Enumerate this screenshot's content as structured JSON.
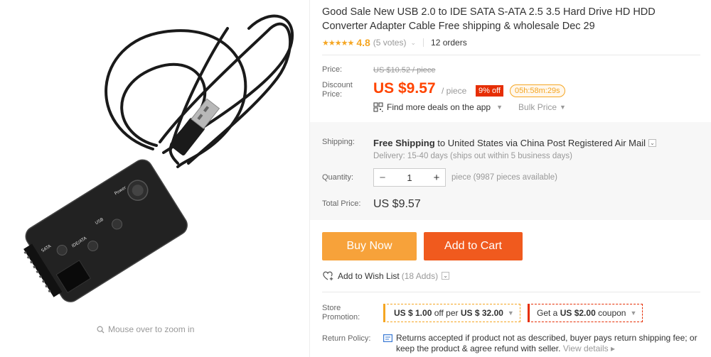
{
  "image": {
    "zoom_hint": "Mouse over to zoom in",
    "device_labels": [
      "Power",
      "USB",
      "IDE/ATA",
      "SATA"
    ]
  },
  "product": {
    "title": "Good Sale New USB 2.0 to IDE SATA S-ATA 2.5 3.5 Hard Drive HD HDD Converter Adapter Cable Free shipping & wholesale Dec 29",
    "stars": "★★★★★",
    "rating": "4.8",
    "votes": "(5 votes)",
    "orders": "12 orders"
  },
  "pricing": {
    "price_label": "Price:",
    "original_price": "US $10.52 / piece",
    "discount_label_1": "Discount",
    "discount_label_2": "Price:",
    "discount_price": "US $9.57",
    "unit": "/ piece",
    "discount_badge": "9% off",
    "countdown": "05h:58m:29s",
    "deals_link": "Find more deals on the app",
    "bulk_price": "Bulk Price"
  },
  "shipping": {
    "label": "Shipping:",
    "free_shipping": "Free Shipping",
    "to": "to",
    "country": "United States",
    "via": "via",
    "carrier": "China Post Registered Air Mail",
    "delivery": "Delivery: 15-40 days (ships out within 5 business days)"
  },
  "quantity": {
    "label": "Quantity:",
    "value": "1",
    "minus": "−",
    "plus": "+",
    "available": "piece (9987 pieces available)"
  },
  "total": {
    "label": "Total Price:",
    "value": "US $9.57"
  },
  "actions": {
    "buy_now": "Buy Now",
    "add_to_cart": "Add to Cart",
    "wishlist": "Add to Wish List",
    "wishlist_count": "(18 Adds)"
  },
  "promotion": {
    "label_1": "Store",
    "label_2": "Promotion:",
    "promo1_a": "US $ 1.00",
    "promo1_b": "off per",
    "promo1_c": "US $ 32.00",
    "promo2_a": "Get a",
    "promo2_b": "US $2.00",
    "promo2_c": "coupon"
  },
  "returns": {
    "label": "Return Policy:",
    "text": "Returns accepted if product not as described, buyer pays return shipping fee; or keep the product & agree refund with seller.",
    "view_details": "View details ▸"
  },
  "colors": {
    "accent_orange": "#ff4400",
    "buy_now": "#f7a23a",
    "add_to_cart": "#f05a1e",
    "star": "#f5a623",
    "badge_red": "#e62e04"
  }
}
